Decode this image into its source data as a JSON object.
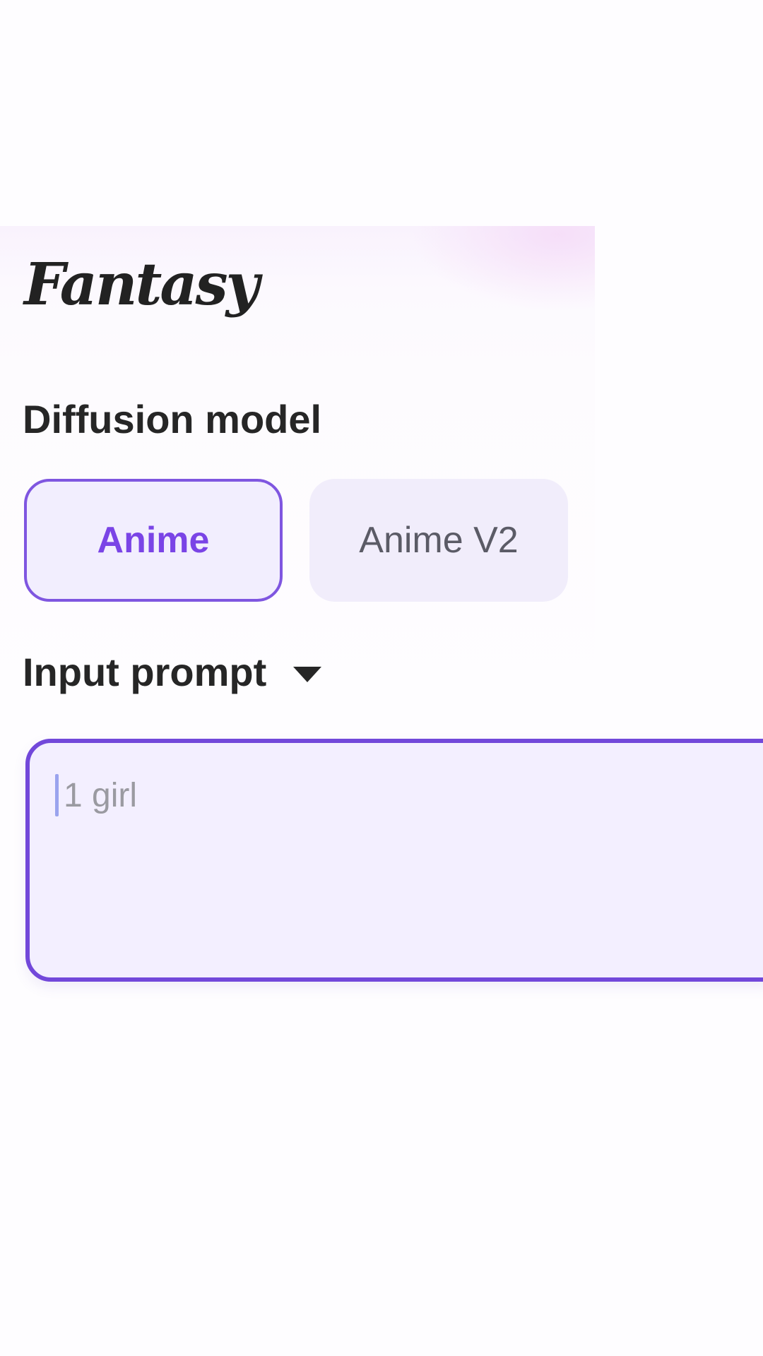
{
  "app": {
    "title": "Fantasy"
  },
  "diffusion_model": {
    "label": "Diffusion model",
    "options": [
      {
        "label": "Anime",
        "selected": true
      },
      {
        "label": "Anime V2",
        "selected": false
      }
    ]
  },
  "input_prompt": {
    "label": "Input prompt",
    "toggle_icon": "caret-down-icon",
    "value": "",
    "placeholder": "1 girl"
  },
  "colors": {
    "accent": "#7248da",
    "accent_text": "#7a44e6",
    "chip_bg": "#f1edfb",
    "field_bg": "#f3efff",
    "heading_text": "#262626"
  }
}
